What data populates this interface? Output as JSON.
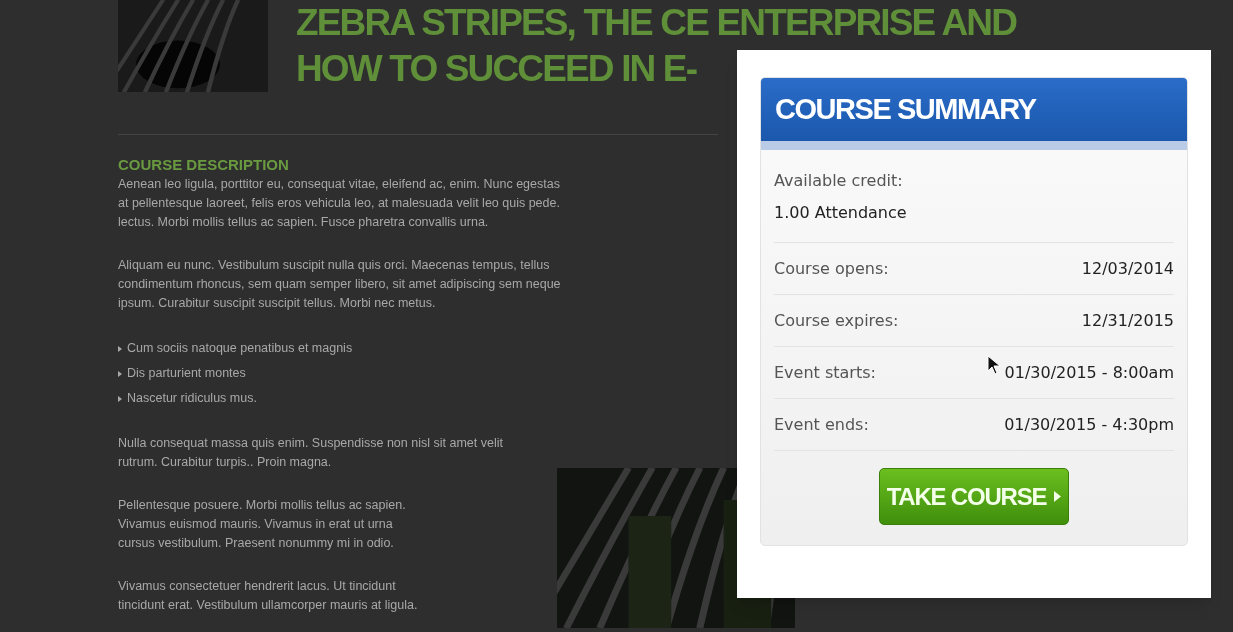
{
  "article": {
    "title_lines": [
      "ZEBRA STRIPES, THE CE ENTERPRISE AND",
      "HOW TO SUCCEED IN E-"
    ],
    "section_heading": "COURSE DESCRIPTION",
    "blocks": [
      {
        "kind": "paragraph",
        "lines": [
          "Aenean leo ligula, porttitor eu, consequat vitae, eleifend ac, enim. Nunc egestas",
          "at pellentesque laoreet, felis eros vehicula leo, at malesuada velit leo quis pede.",
          "lectus. Morbi mollis tellus ac sapien. Fusce pharetra convallis urna."
        ]
      },
      {
        "kind": "paragraph",
        "lines": [
          "Aliquam eu nunc. Vestibulum suscipit nulla quis orci. Maecenas tempus, tellus",
          "condimentum rhoncus, sem quam semper libero, sit amet adipiscing sem neque",
          "ipsum. Curabitur suscipit suscipit tellus. Morbi nec metus."
        ]
      },
      {
        "kind": "list",
        "lines": [
          "Cum sociis natoque penatibus et magnis",
          "Dis parturient montes",
          "Nascetur ridiculus mus."
        ]
      },
      {
        "kind": "paragraph",
        "lines": [
          "Nulla consequat massa quis enim. Suspendisse non nisl sit amet velit",
          "rutrum. Curabitur turpis.. Proin magna."
        ]
      },
      {
        "kind": "paragraph",
        "lines": [
          "Pellentesque posuere. Morbi mollis tellus ac sapien.",
          "Vivamus euismod mauris. Vivamus in erat ut urna",
          "cursus vestibulum. Praesent nonummy mi in odio."
        ]
      },
      {
        "kind": "paragraph",
        "lines": [
          "Vivamus consectetuer hendrerit lacus. Ut tincidunt",
          "tincidunt erat. Vestibulum ullamcorper mauris at ligula."
        ]
      }
    ]
  },
  "summary": {
    "title": "COURSE SUMMARY",
    "credit": {
      "label": "Available credit:",
      "value": "1.00 Attendance"
    },
    "rows": [
      {
        "label": "Course opens:",
        "value": "12/03/2014"
      },
      {
        "label": "Course expires:",
        "value": "12/31/2015"
      },
      {
        "label": "Event starts:",
        "value": "01/30/2015 - 8:00am"
      },
      {
        "label": "Event ends:",
        "value": "01/30/2015 - 4:30pm"
      }
    ],
    "button": "TAKE COURSE"
  }
}
